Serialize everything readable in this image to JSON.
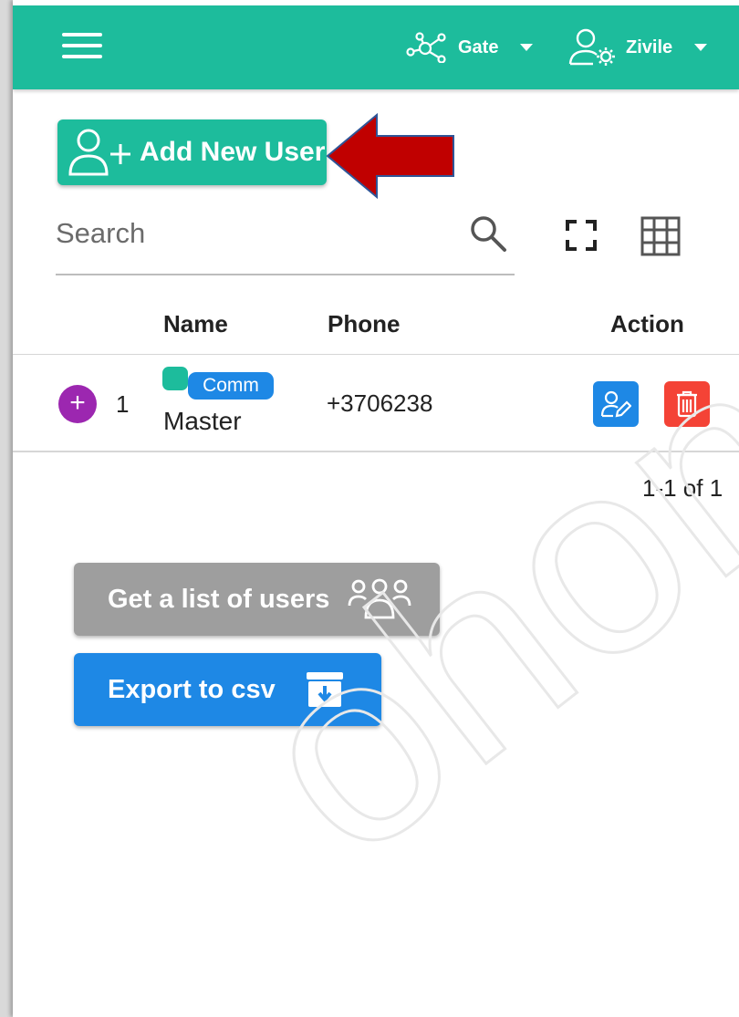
{
  "app_bar": {
    "gate_label": "Gate",
    "user_label": "Zivile",
    "background": "#1dbc9c"
  },
  "toolbar": {
    "add_user_label": "Add New User",
    "search_placeholder": "Search"
  },
  "table": {
    "columns": [
      "Name",
      "Phone",
      "Action"
    ],
    "rows": [
      {
        "index": "1",
        "tag": "Comm",
        "name": "Master",
        "phone": "+3706238"
      }
    ],
    "pagination": "1-1 of 1"
  },
  "actions": {
    "list_users_label": "Get a list of users",
    "export_label": "Export to csv"
  },
  "colors": {
    "primary_teal": "#1dbc9c",
    "blue": "#1e88e5",
    "red": "#f44336",
    "purple": "#9c27b0",
    "grey_button": "#9e9e9e",
    "arrow_red": "#c00000"
  },
  "icons": {
    "menu": "hamburger-icon",
    "gate": "network-nodes-icon",
    "user_settings": "user-gear-icon",
    "add_user": "user-plus-icon",
    "search": "search-icon",
    "fullscreen": "fullscreen-icon",
    "columns": "grid-icon",
    "edit": "user-edit-icon",
    "delete": "trash-icon",
    "group": "users-group-icon",
    "export": "archive-download-icon"
  }
}
